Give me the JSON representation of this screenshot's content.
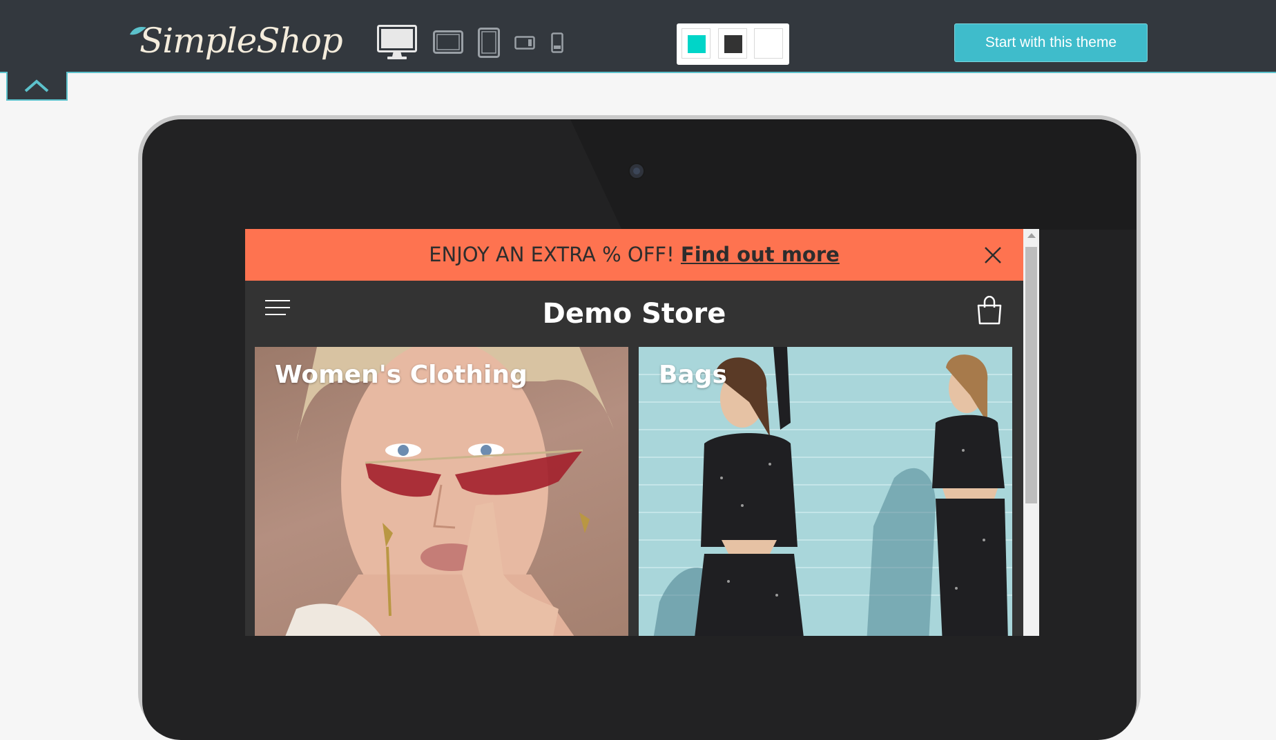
{
  "topbar": {
    "logo_text": "SimpleShop",
    "devices": [
      {
        "name": "desktop-icon",
        "selected": true
      },
      {
        "name": "laptop-icon",
        "selected": false
      },
      {
        "name": "tablet-icon",
        "selected": false
      },
      {
        "name": "tablet-landscape-icon",
        "selected": false
      },
      {
        "name": "phone-icon",
        "selected": false
      }
    ],
    "swatches": [
      "#00d5c8",
      "#333333",
      "#ffffff"
    ],
    "start_button": "Start with this theme",
    "accent_color": "#3fbccb"
  },
  "store": {
    "promo": {
      "text": "ENJOY AN EXTRA % OFF!",
      "link": "Find out more",
      "background": "#fe7350"
    },
    "title": "Demo Store",
    "collections": [
      {
        "label": "Women's Clothing"
      },
      {
        "label": "Bags"
      }
    ]
  }
}
